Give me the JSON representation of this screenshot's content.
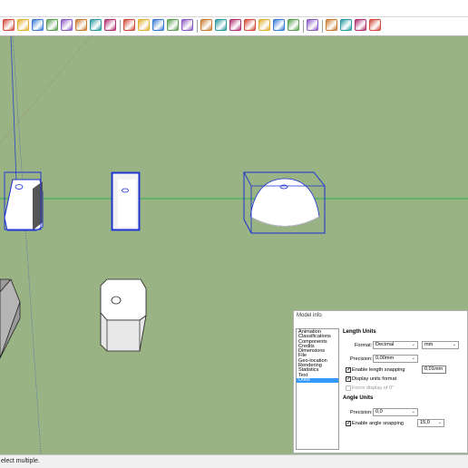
{
  "toolbar": {
    "icons": [
      "select-icon",
      "paint-bucket-icon",
      "text-icon",
      "3d-text-icon",
      "component-icon",
      "paint-icon",
      "search-icon",
      "delete-icon",
      "scenes-icon",
      "styles-icon",
      "layers-icon",
      "shadow-icon",
      "section-icon",
      "material-icon",
      "view-iso-icon",
      "view-top-icon",
      "view-front-icon",
      "view-right-icon",
      "view-back-icon",
      "view-left-icon",
      "orbit-icon",
      "warehouse-icon",
      "extension-icon",
      "3d-warehouse-icon",
      "sandbox-icon"
    ],
    "accent": "#2a66c8"
  },
  "viewport": {
    "background": "#99b385",
    "selection_color": "#1a2fd6",
    "axis_green": "#2fb04a",
    "axis_red": "#d03030"
  },
  "dialog": {
    "title": "Model info",
    "categories": [
      "Animation",
      "Classifications",
      "Components",
      "Credits",
      "Dimensions",
      "File",
      "Geo-location",
      "Rendering",
      "Statistics",
      "Text",
      "Units"
    ],
    "selected_category": "Units",
    "length_units": {
      "title": "Length Units",
      "format_label": "Format:",
      "format_value": "Decimal",
      "unit_value": "mm",
      "precision_label": "Precision:",
      "precision_value": "0,00mm",
      "snapping_label": "Enable length snapping",
      "snapping_value": "0,01mm",
      "display_units_label": "Display units format",
      "force_label": "Force display of 0\""
    },
    "angle_units": {
      "title": "Angle Units",
      "precision_label": "Precision:",
      "precision_value": "0,0",
      "snapping_label": "Enable angle snapping",
      "snapping_value": "15,0"
    }
  },
  "status": {
    "text": "elect multiple."
  }
}
